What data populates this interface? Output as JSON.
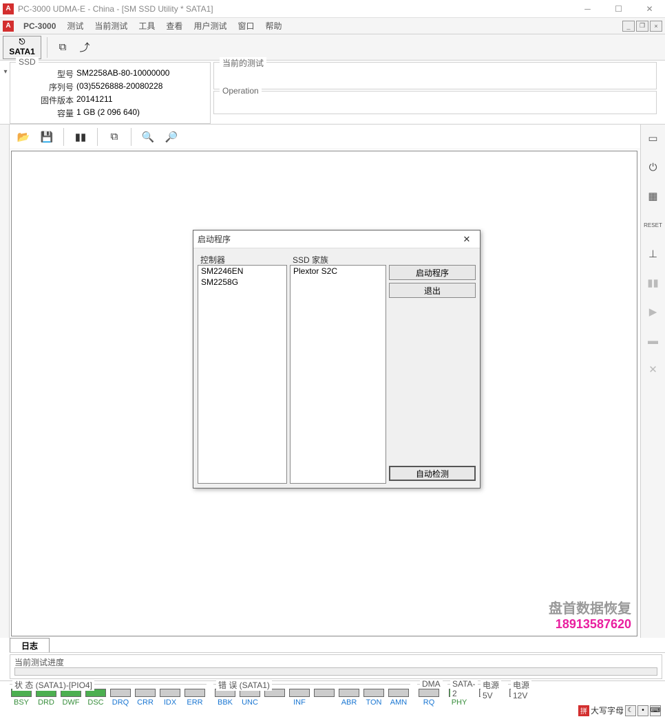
{
  "title": "PC-3000 UDMA-E - China - [SM SSD Utility * SATA1]",
  "menubar": {
    "brand": "PC-3000",
    "items": [
      "测试",
      "当前测试",
      "工具",
      "查看",
      "用户测试",
      "窗口",
      "帮助"
    ]
  },
  "toolbar": {
    "sata_tab": "SATA1"
  },
  "ssd_panel": {
    "legend": "SSD",
    "rows": [
      {
        "label": "型号",
        "value": "SM2258AB-80-10000000"
      },
      {
        "label": "序列号",
        "value": "(03)5526888-20080228"
      },
      {
        "label": "固件版本",
        "value": "20141211"
      },
      {
        "label": "容量",
        "value": "1 GB (2 096 640)"
      }
    ]
  },
  "right_panels": {
    "p1": "当前的测试",
    "p2": "Operation"
  },
  "watermark": {
    "line1": "盘首数据恢复",
    "line2": "18913587620"
  },
  "log_tab": "日志",
  "progress_label": "当前测试进度",
  "status": {
    "group1": {
      "label": "状 态 (SATA1)-[PIO4]",
      "leds": [
        {
          "name": "BSY",
          "on": true
        },
        {
          "name": "DRD",
          "on": true
        },
        {
          "name": "DWF",
          "on": true
        },
        {
          "name": "DSC",
          "on": true
        },
        {
          "name": "DRQ",
          "on": false
        },
        {
          "name": "CRR",
          "on": false
        },
        {
          "name": "IDX",
          "on": false
        },
        {
          "name": "ERR",
          "on": false
        }
      ]
    },
    "group2": {
      "label": "错 误 (SATA1)",
      "leds": [
        {
          "name": "BBK",
          "on": false
        },
        {
          "name": "UNC",
          "on": false
        },
        {
          "name": "",
          "on": false
        },
        {
          "name": "INF",
          "on": false
        },
        {
          "name": "",
          "on": false
        },
        {
          "name": "ABR",
          "on": false
        },
        {
          "name": "TON",
          "on": false
        },
        {
          "name": "AMN",
          "on": false
        }
      ]
    },
    "group3": {
      "label": "DMA",
      "leds": [
        {
          "name": "RQ",
          "on": false
        }
      ]
    },
    "group4": {
      "label": "SATA-2",
      "leds": [
        {
          "name": "PHY",
          "on": true
        }
      ]
    },
    "group5": {
      "label": "电源 5V",
      "leds": [
        {
          "name": "",
          "on": false
        }
      ]
    },
    "group6": {
      "label": "电源 12V",
      "leds": [
        {
          "name": "",
          "on": false
        }
      ]
    }
  },
  "ime": {
    "text": "大写字母"
  },
  "dialog": {
    "title": "启动程序",
    "col1_header": "控制器",
    "col1_items": [
      "SM2246EN",
      "SM2258G"
    ],
    "col2_header": "SSD 家族",
    "col2_items": [
      "Plextor S2C"
    ],
    "btn_start": "启动程序",
    "btn_exit": "退出",
    "btn_auto": "自动检测"
  }
}
